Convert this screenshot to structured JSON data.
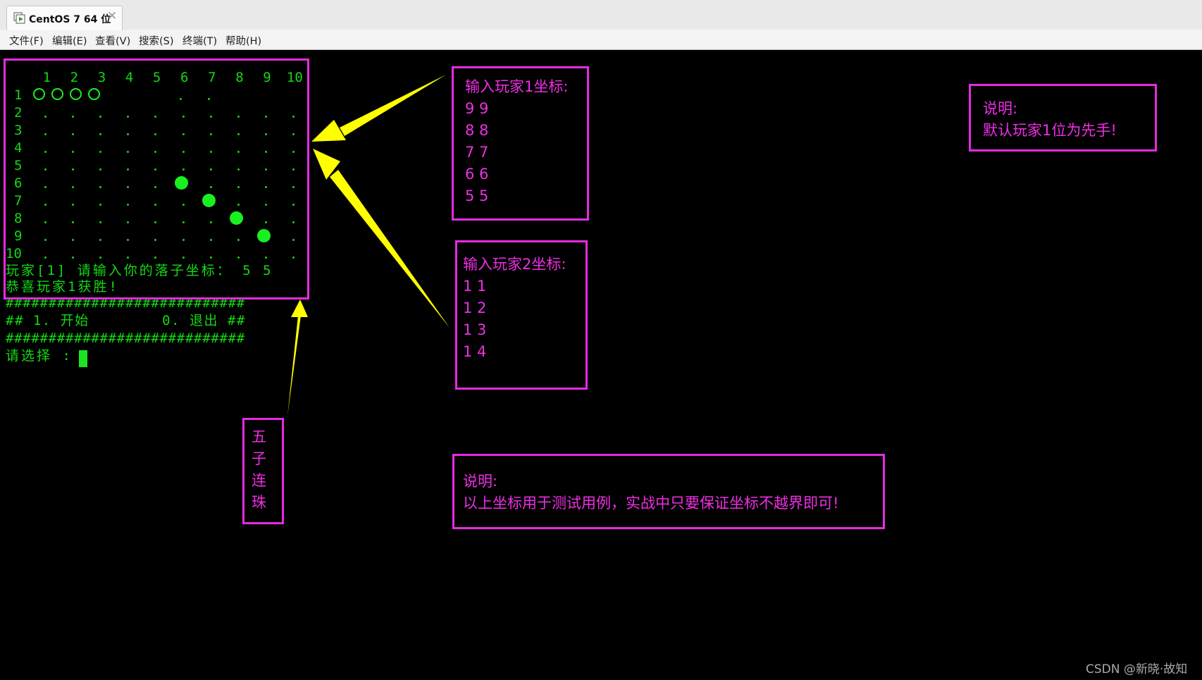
{
  "window": {
    "tab_title": "CentOS 7 64 位",
    "close_glyph": "✕"
  },
  "menu": [
    "文件(F)",
    "编辑(E)",
    "查看(V)",
    "搜索(S)",
    "终端(T)",
    "帮助(H)"
  ],
  "board": {
    "size": 10,
    "column_labels": [
      "1",
      "2",
      "3",
      "4",
      "5",
      "6",
      "7",
      "8",
      "9",
      "10"
    ],
    "row_labels": [
      "1",
      "2",
      "3",
      "4",
      "5",
      "6",
      "7",
      "8",
      "9",
      "10"
    ],
    "empty_glyph": ".",
    "player1_stones": [
      [
        6,
        6
      ],
      [
        7,
        7
      ],
      [
        8,
        8
      ],
      [
        9,
        9
      ]
    ],
    "player2_stones": [
      [
        1,
        1
      ],
      [
        1,
        2
      ],
      [
        1,
        3
      ],
      [
        1,
        4
      ]
    ]
  },
  "terminal": {
    "prompt_move": "玩家[1] 请输入你的落子坐标： 5 5",
    "win_message": "恭喜玩家1获胜!",
    "divider": "############################",
    "menu_line": "## 1. 开始        0. 退出 ##",
    "select_prompt": "请选择 :"
  },
  "annotations": {
    "player1_title": "输入玩家1坐标:",
    "player1_coords": [
      "9 9",
      "8 8",
      "7 7",
      "6 6",
      "5 5"
    ],
    "player2_title": "输入玩家2坐标:",
    "player2_coords": [
      "1 1",
      "1 2",
      "1 3",
      "1 4"
    ],
    "note_top_title": "说明:",
    "note_top_text": "默认玩家1位为先手!",
    "game_name_chars": [
      "五",
      "子",
      "连",
      "珠"
    ],
    "note_bottom_title": "说明:",
    "note_bottom_text": "以上坐标用于测试用例，实战中只要保证坐标不越界即可!"
  },
  "watermark": "CSDN @新晓·故知",
  "colors": {
    "terminal_green": "#14d814",
    "stone_green": "#19f01f",
    "annotation_magenta": "#e62be0",
    "arrow_yellow": "#ffff00"
  }
}
